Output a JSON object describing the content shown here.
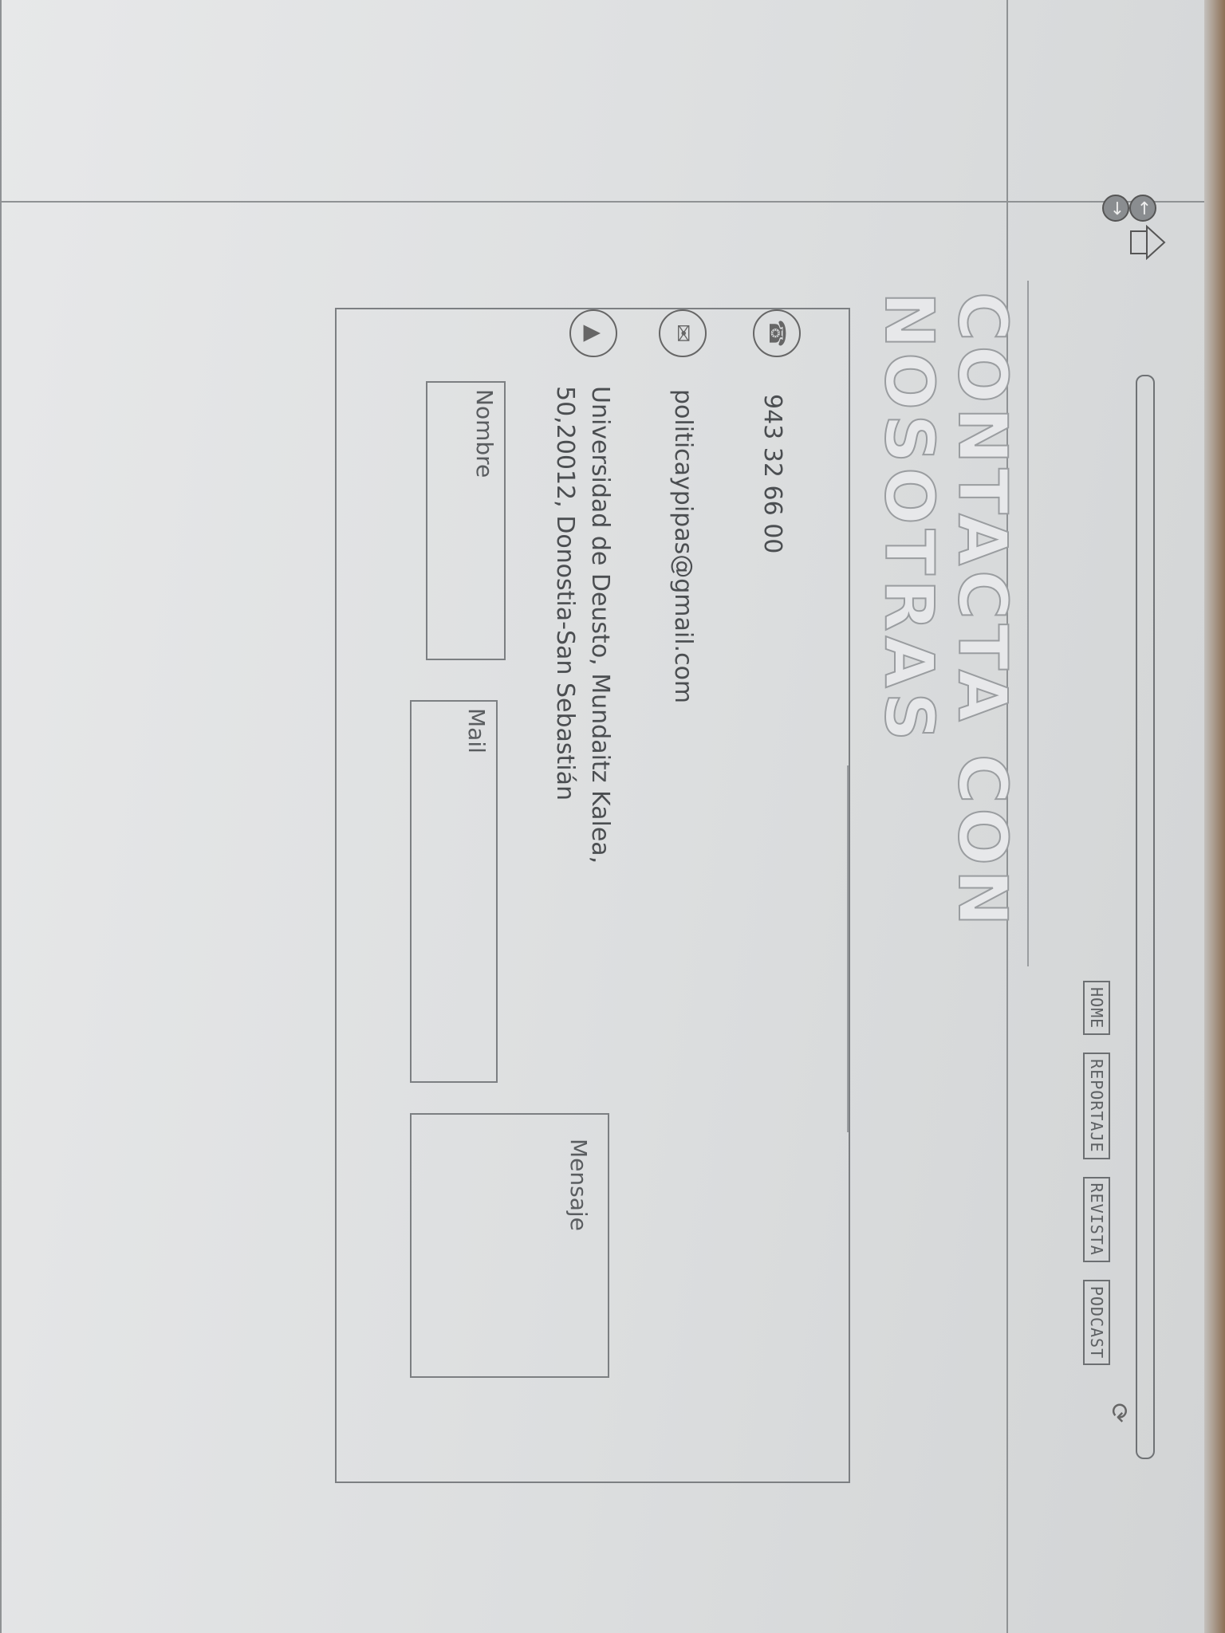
{
  "browser": {
    "back_icon": "back-arrow-icon",
    "forward_icon": "forward-arrow-icon",
    "home_icon": "home-icon",
    "reload_icon": "reload-icon"
  },
  "nav": {
    "tabs": [
      {
        "label": "HOME"
      },
      {
        "label": "REPORTAJE"
      },
      {
        "label": "REVISTA"
      },
      {
        "label": "PODCAST"
      }
    ]
  },
  "page": {
    "title": "CONTACTA CON NOSOTRAS"
  },
  "contact": {
    "phone": "943 32 66 00",
    "email": "politicaypipas@gmail.com",
    "address": "Universidad de Deusto, Mundaitz Kalea,\n50,20012, Donostia-San Sebastián",
    "phone_icon": "phone-icon",
    "email_icon": "envelope-icon",
    "address_icon": "location-pin-icon"
  },
  "form": {
    "name_label": "Nombre",
    "mail_label": "Mail",
    "message_label": "Mensaje"
  }
}
